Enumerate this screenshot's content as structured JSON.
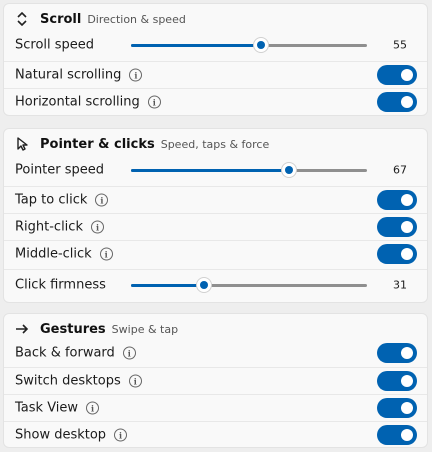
{
  "accent": "#0062b1",
  "scroll": {
    "title": "Scroll",
    "subtitle": "Direction & speed",
    "icon": "up-down-chevrons-icon",
    "speed_label": "Scroll speed",
    "speed_value": 55,
    "natural_label": "Natural scrolling",
    "natural_on": true,
    "horizontal_label": "Horizontal scrolling",
    "horizontal_on": true
  },
  "pointer": {
    "title": "Pointer & clicks",
    "subtitle": "Speed, taps & force",
    "icon": "mouse-pointer-icon",
    "speed_label": "Pointer speed",
    "speed_value": 67,
    "tap_label": "Tap to click",
    "tap_on": true,
    "right_label": "Right-click",
    "right_on": true,
    "middle_label": "Middle-click",
    "middle_on": true,
    "firmness_label": "Click firmness",
    "firmness_value": 31
  },
  "gestures": {
    "title": "Gestures",
    "subtitle": "Swipe & tap",
    "icon": "right-arrow-icon",
    "back_label": "Back & forward",
    "back_on": true,
    "switch_label": "Switch desktops",
    "switch_on": true,
    "taskview_label": "Task View",
    "taskview_on": true,
    "showdesk_label": "Show desktop",
    "showdesk_on": true
  }
}
